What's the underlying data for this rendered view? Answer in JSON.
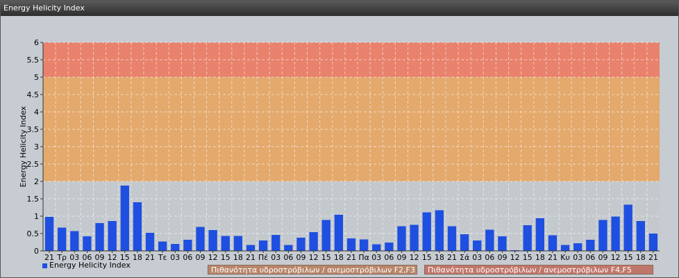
{
  "window": {
    "title": "Energy Helicity Index"
  },
  "colors": {
    "bar": "#1e4fe0",
    "band_low": "#c3c8cc",
    "band_mid": "#e3a86a",
    "band_high": "#e8806a",
    "legend_mid": "#b8866a",
    "legend_high": "#c0766a"
  },
  "legend": {
    "series_label": "Energy Helicity Index",
    "band_mid_label": "Πιθανότητα υδροστρόβιλων / ανεμοστρόβιλων F2,F3",
    "band_high_label": "Πιθανότητα υδροστρόβιλων / ανεμοστρόβιλων F4,F5"
  },
  "chart_data": {
    "type": "bar",
    "ylabel": "Energy Helicity Index",
    "ylim": [
      0,
      6
    ],
    "yticks": [
      "0",
      "0.5",
      "1",
      "1.5",
      "2",
      "2.5",
      "3",
      "3.5",
      "4",
      "4.5",
      "5",
      "5.5",
      "6"
    ],
    "bands": [
      {
        "from": 0,
        "to": 2,
        "color": "#c3c8cc"
      },
      {
        "from": 2,
        "to": 5,
        "color": "#e3a86a"
      },
      {
        "from": 5,
        "to": 6,
        "color": "#e8806a"
      }
    ],
    "categories": [
      "21",
      "Τρ",
      "03",
      "06",
      "09",
      "12",
      "15",
      "18",
      "21",
      "Τε",
      "03",
      "06",
      "09",
      "12",
      "15",
      "18",
      "21",
      "Πέ",
      "03",
      "06",
      "09",
      "12",
      "15",
      "18",
      "21",
      "Πα",
      "03",
      "06",
      "09",
      "12",
      "15",
      "18",
      "21",
      "Σά",
      "03",
      "06",
      "09",
      "12",
      "15",
      "18",
      "21",
      "Κυ",
      "03",
      "06",
      "09",
      "12",
      "15",
      "18",
      "21"
    ],
    "series": [
      {
        "name": "Energy Helicity Index",
        "values": [
          0.98,
          0.67,
          0.57,
          0.42,
          0.8,
          0.86,
          1.88,
          1.4,
          0.52,
          0.27,
          0.2,
          0.32,
          0.69,
          0.6,
          0.43,
          0.43,
          0.17,
          0.3,
          0.46,
          0.17,
          0.38,
          0.54,
          0.89,
          1.04,
          0.36,
          0.33,
          0.19,
          0.24,
          0.71,
          0.75,
          1.11,
          1.17,
          0.71,
          0.48,
          0.3,
          0.61,
          0.42,
          0.02,
          0.74,
          0.94,
          0.45,
          0.17,
          0.22,
          0.32,
          0.89,
          0.99,
          1.33,
          0.86,
          0.5
        ]
      }
    ]
  }
}
